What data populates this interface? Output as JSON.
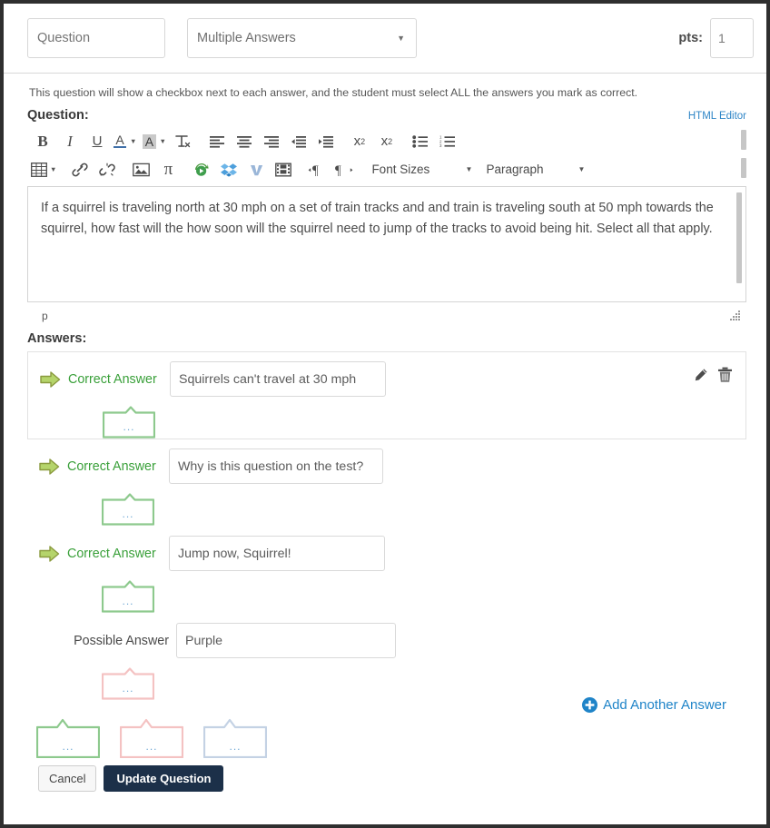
{
  "header": {
    "question_name_placeholder": "Question",
    "question_name_value": "",
    "question_type": "Multiple Answers",
    "pts_label": "pts:",
    "pts_value": "1"
  },
  "hint": "This question will show a checkbox next to each answer, and the student must select ALL the answers you mark as correct.",
  "question_section": {
    "label": "Question:",
    "html_editor_link": "HTML Editor"
  },
  "toolbar": {
    "row1": [
      {
        "name": "bold-icon",
        "label": "B"
      },
      {
        "name": "italic-icon",
        "label": "I"
      },
      {
        "name": "underline-icon",
        "label": "U"
      },
      {
        "name": "text-color-icon",
        "label": "A"
      },
      {
        "name": "background-color-icon",
        "label": "A"
      },
      {
        "name": "clear-formatting-icon",
        "label": "Tx"
      },
      {
        "name": "align-left-icon",
        "label": "align-left"
      },
      {
        "name": "align-center-icon",
        "label": "align-center"
      },
      {
        "name": "align-right-icon",
        "label": "align-right"
      },
      {
        "name": "outdent-icon",
        "label": "outdent"
      },
      {
        "name": "indent-icon",
        "label": "indent"
      },
      {
        "name": "superscript-icon",
        "label": "x2"
      },
      {
        "name": "subscript-icon",
        "label": "x2"
      },
      {
        "name": "bullet-list-icon",
        "label": "bullets"
      },
      {
        "name": "numbered-list-icon",
        "label": "numbers"
      }
    ],
    "row2": [
      {
        "name": "table-icon",
        "label": "table"
      },
      {
        "name": "link-icon",
        "label": "link"
      },
      {
        "name": "unlink-icon",
        "label": "unlink"
      },
      {
        "name": "image-icon",
        "label": "image"
      },
      {
        "name": "math-equation-icon",
        "label": "π"
      },
      {
        "name": "media-record-icon",
        "label": "record"
      },
      {
        "name": "dropbox-icon",
        "label": "dropbox"
      },
      {
        "name": "vimeo-icon",
        "label": "V"
      },
      {
        "name": "film-icon",
        "label": "film"
      },
      {
        "name": "ltr-direction-icon",
        "label": "ltr"
      },
      {
        "name": "rtl-direction-icon",
        "label": "rtl"
      }
    ],
    "font_sizes": "Font Sizes",
    "paragraph": "Paragraph"
  },
  "editor": {
    "body": "If a squirrel is traveling north at 30 mph on a set of train tracks and and train is traveling south at 50 mph towards the squirrel, how fast will the how soon will the squirrel need to jump of the tracks to avoid being hit. Select all that apply.",
    "status_path": "p"
  },
  "answers_section": {
    "label": "Answers:",
    "bubble_dots": "...",
    "add_another": "Add Another Answer",
    "items": [
      {
        "status": "Correct Answer",
        "correct": true,
        "selected": true,
        "text": "Squirrels can't travel at 30 mph",
        "bubble_color": "#8dc98d"
      },
      {
        "status": "Correct Answer",
        "correct": true,
        "selected": false,
        "text": "Why is this question on the test?",
        "bubble_color": "#8dc98d"
      },
      {
        "status": "Correct Answer",
        "correct": true,
        "selected": false,
        "text": "Jump now, Squirrel!",
        "bubble_color": "#8dc98d"
      },
      {
        "status": "Possible Answer",
        "correct": false,
        "selected": false,
        "text": "Purple",
        "bubble_color": "#f4c2c2"
      }
    ],
    "row_actions": [
      {
        "name": "edit-answer-icon",
        "label": "edit"
      },
      {
        "name": "delete-answer-icon",
        "label": "delete"
      }
    ],
    "bottom_bubbles": [
      {
        "name": "correct-comment-bubble",
        "color": "#8dc98d"
      },
      {
        "name": "incorrect-comment-bubble",
        "color": "#f4c2c2"
      },
      {
        "name": "general-comment-bubble",
        "color": "#c4d2e4"
      }
    ]
  },
  "footer": {
    "cancel": "Cancel",
    "update": "Update Question"
  },
  "colors": {
    "correct_green": "#3aa03a",
    "link_blue": "#1f84c8",
    "primary_button": "#1c3049",
    "dots_blue": "#6fa8d4"
  }
}
